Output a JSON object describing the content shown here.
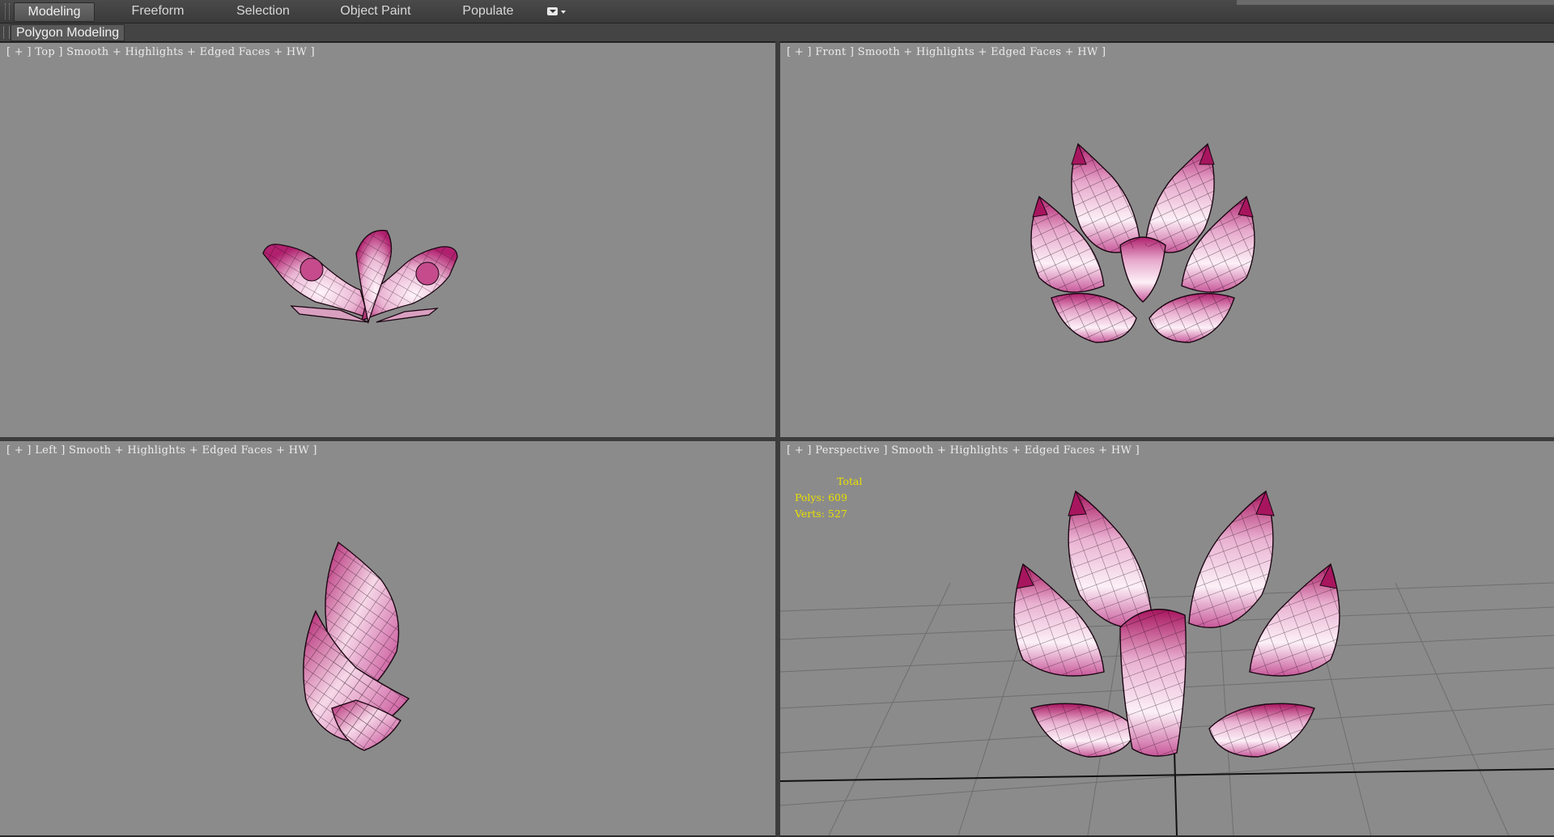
{
  "ribbon": {
    "tabs": [
      "Modeling",
      "Freeform",
      "Selection",
      "Object Paint",
      "Populate"
    ],
    "active_tab": "Modeling",
    "panel_label": "Polygon Modeling"
  },
  "viewports": {
    "top": {
      "label": "[ + ] Top ] Smooth + Highlights + Edged Faces + HW ]"
    },
    "front": {
      "label": "[ + ] Front ] Smooth + Highlights + Edged Faces + HW ]"
    },
    "left": {
      "label": "[ + ] Left ] Smooth + Highlights + Edged Faces + HW ]"
    },
    "perspective": {
      "label": "[ + ] Perspective ] Smooth + Highlights + Edged Faces + HW ]",
      "stats": {
        "total_label": "Total",
        "polys_label": "Polys:",
        "polys_value": "609",
        "verts_label": "Verts:",
        "verts_value": "527"
      }
    }
  },
  "colors": {
    "viewport_bg": "#8b8b8b",
    "mesh_dark": "#b0206e",
    "mesh_light": "#fbeef6",
    "stats_text": "#e8e000"
  }
}
